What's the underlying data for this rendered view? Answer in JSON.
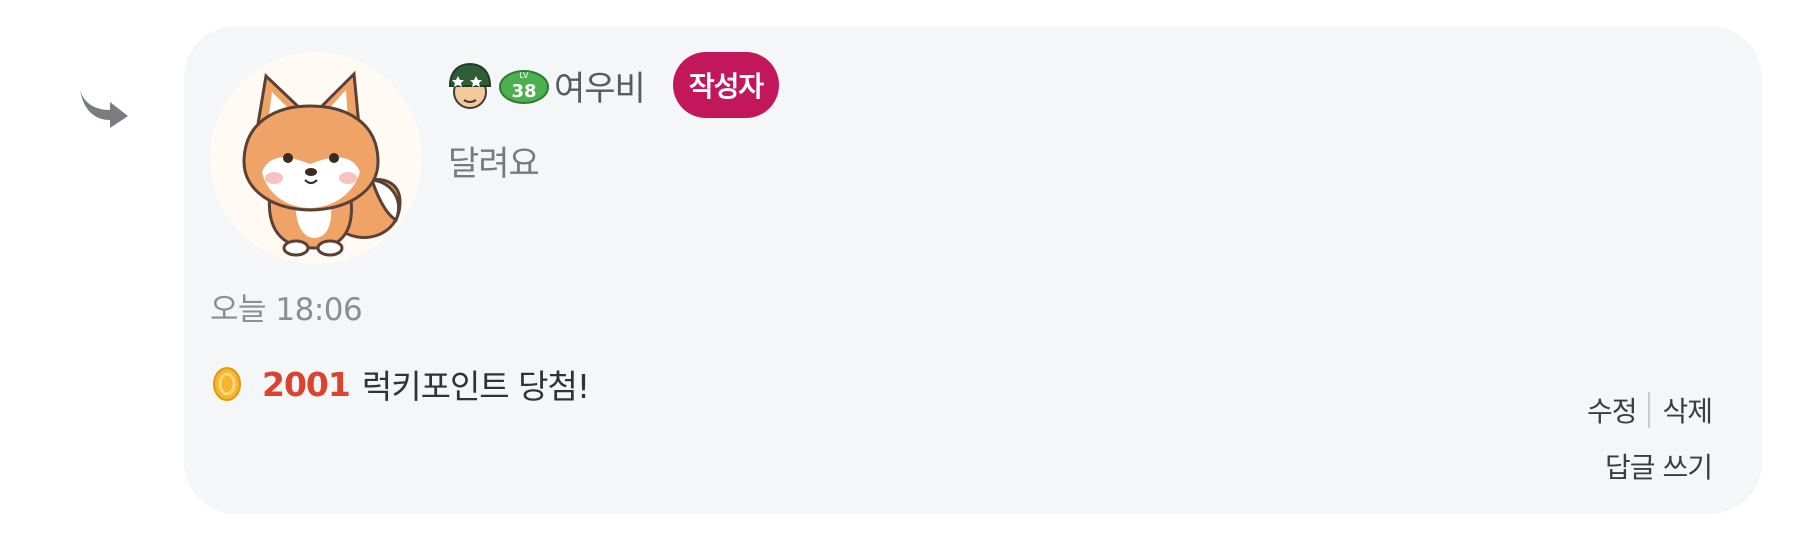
{
  "comment": {
    "author": {
      "nickname": "여우비",
      "level_label": "LV",
      "level": "38",
      "writer_badge": "작성자",
      "rank_icon": "soldier-helmet-icon",
      "avatar": "fox-avatar"
    },
    "body": "달려요",
    "date": "오늘 18:06",
    "lucky": {
      "icon": "coin-icon",
      "number": "2001",
      "text": "럭키포인트 당첨!"
    },
    "actions": {
      "edit": "수정",
      "delete": "삭제",
      "reply": "답글 쓰기"
    }
  },
  "colors": {
    "card_background": "#f5f6f8",
    "writer_badge": "#c2185b",
    "lucky_number": "#d9432f",
    "level_badge": "#4caf50"
  }
}
